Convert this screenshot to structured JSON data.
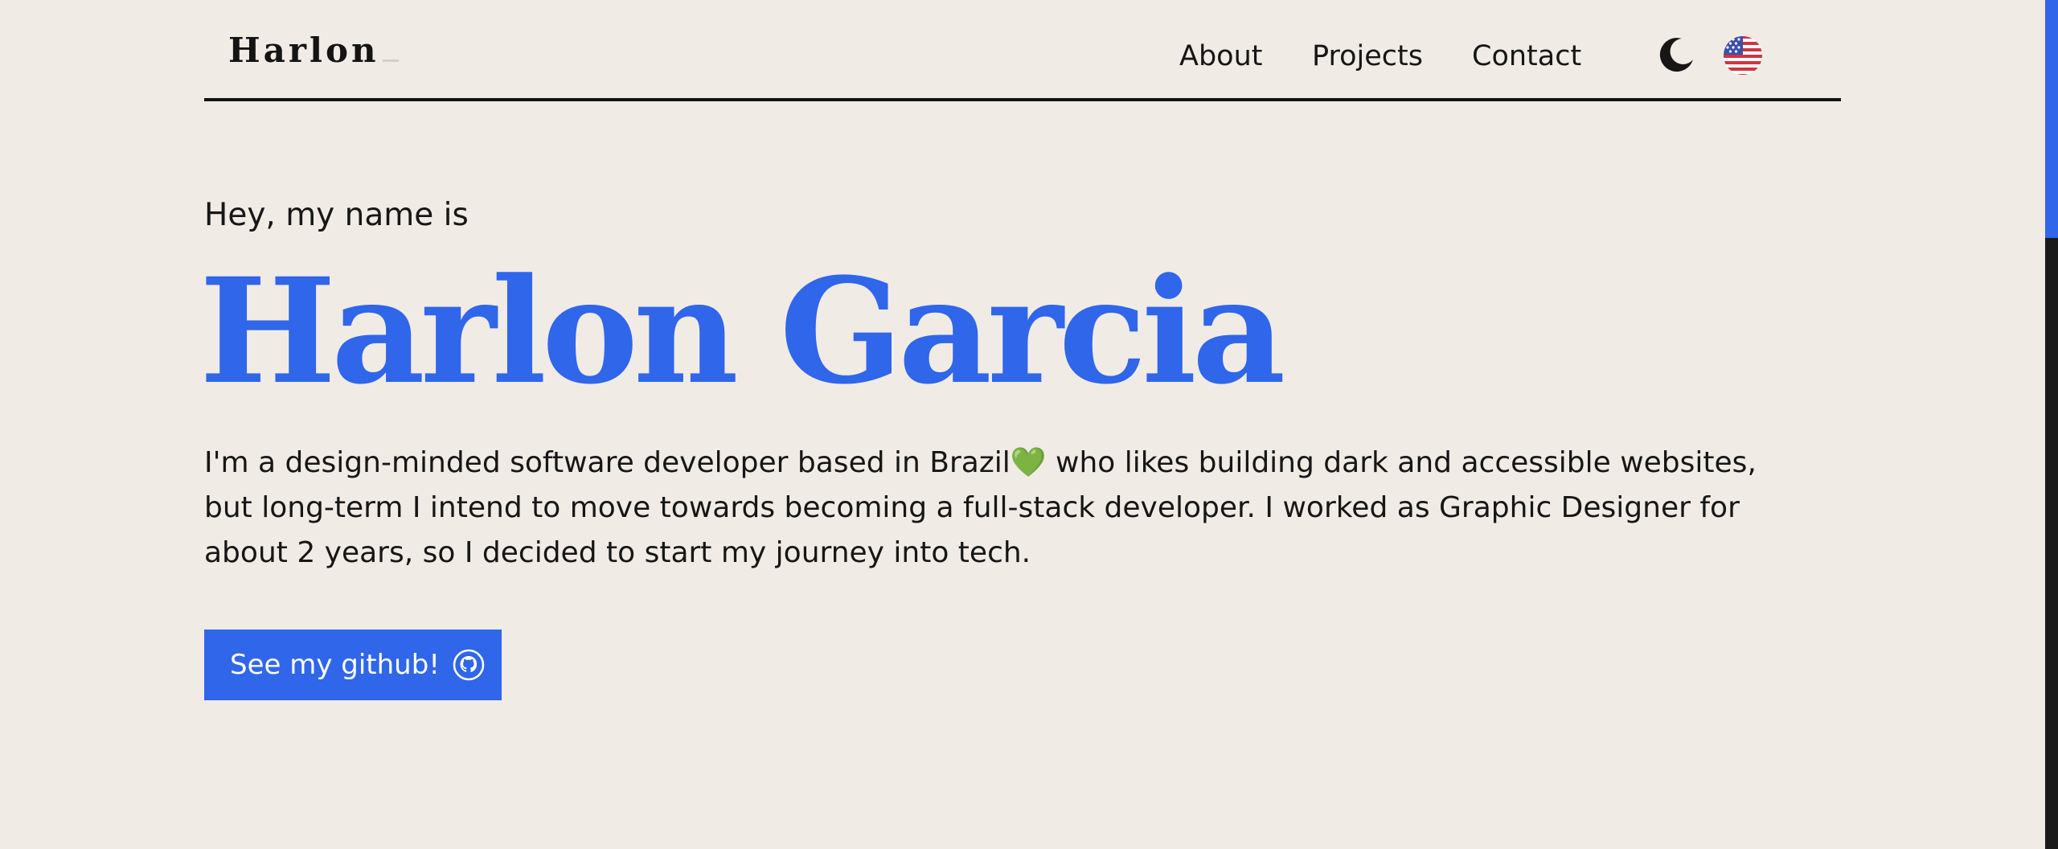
{
  "header": {
    "logo": "Harlon",
    "nav": {
      "about": "About",
      "projects": "Projects",
      "contact": "Contact"
    },
    "theme_icon": "moon-icon",
    "language_icon": "us-flag-icon"
  },
  "hero": {
    "greeting": "Hey, my name is",
    "name": "Harlon Garcia",
    "bio": {
      "line1_before": "I'm a design-minded software developer based in Brazil",
      "heart": "💚",
      "line1_after": " who likes building dark and accessible websites,",
      "line2": "but long-term I intend to move towards becoming a full-stack developer. I worked as Graphic Designer for",
      "line3": "about 2 years, so I decided to start my journey into tech."
    },
    "cta_label": "See my github!",
    "cta_icon": "github-icon"
  },
  "colors": {
    "background": "#f1ebe6",
    "accent": "#2f66ea",
    "text": "#161616",
    "scrollbar_track": "#1a1a1a"
  }
}
